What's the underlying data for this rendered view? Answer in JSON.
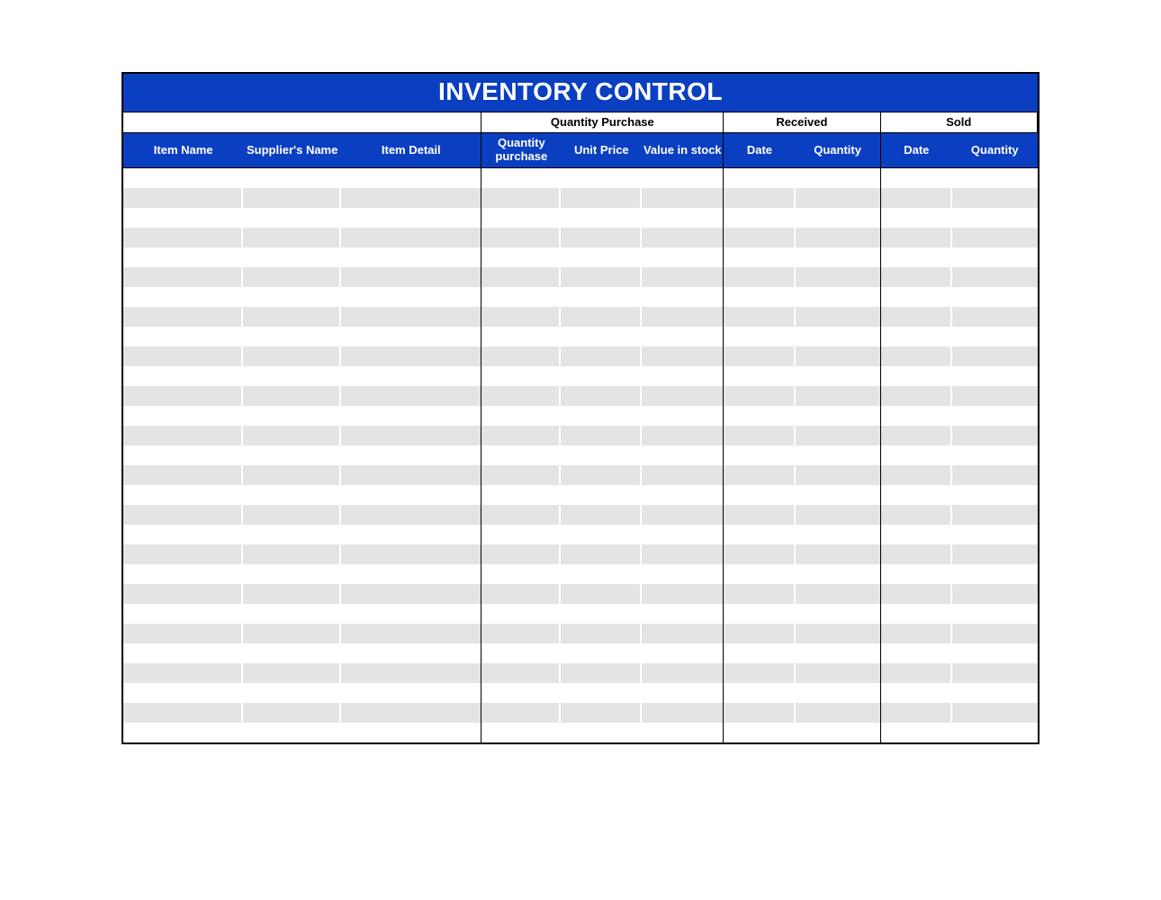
{
  "title": "INVENTORY CONTROL",
  "groups": {
    "blank": "",
    "qty_purchase": "Quantity Purchase",
    "received": "Received",
    "sold": "Sold"
  },
  "columns": {
    "item_name": "Item Name",
    "supplier": "Supplier's Name",
    "item_detail": "Item Detail",
    "qty_purchase": "Quantity purchase",
    "unit_price": "Unit Price",
    "value_in_stock": "Value in stock",
    "recv_date": "Date",
    "recv_qty": "Quantity",
    "sold_date": "Date",
    "sold_qty": "Quantity"
  },
  "rows": [
    {},
    {},
    {},
    {},
    {},
    {},
    {},
    {},
    {},
    {},
    {},
    {},
    {},
    {},
    {},
    {},
    {},
    {},
    {},
    {},
    {},
    {},
    {},
    {},
    {},
    {},
    {},
    {},
    {}
  ],
  "colors": {
    "brand": "#0b3fc1",
    "stripe": "#e4e4e4"
  }
}
